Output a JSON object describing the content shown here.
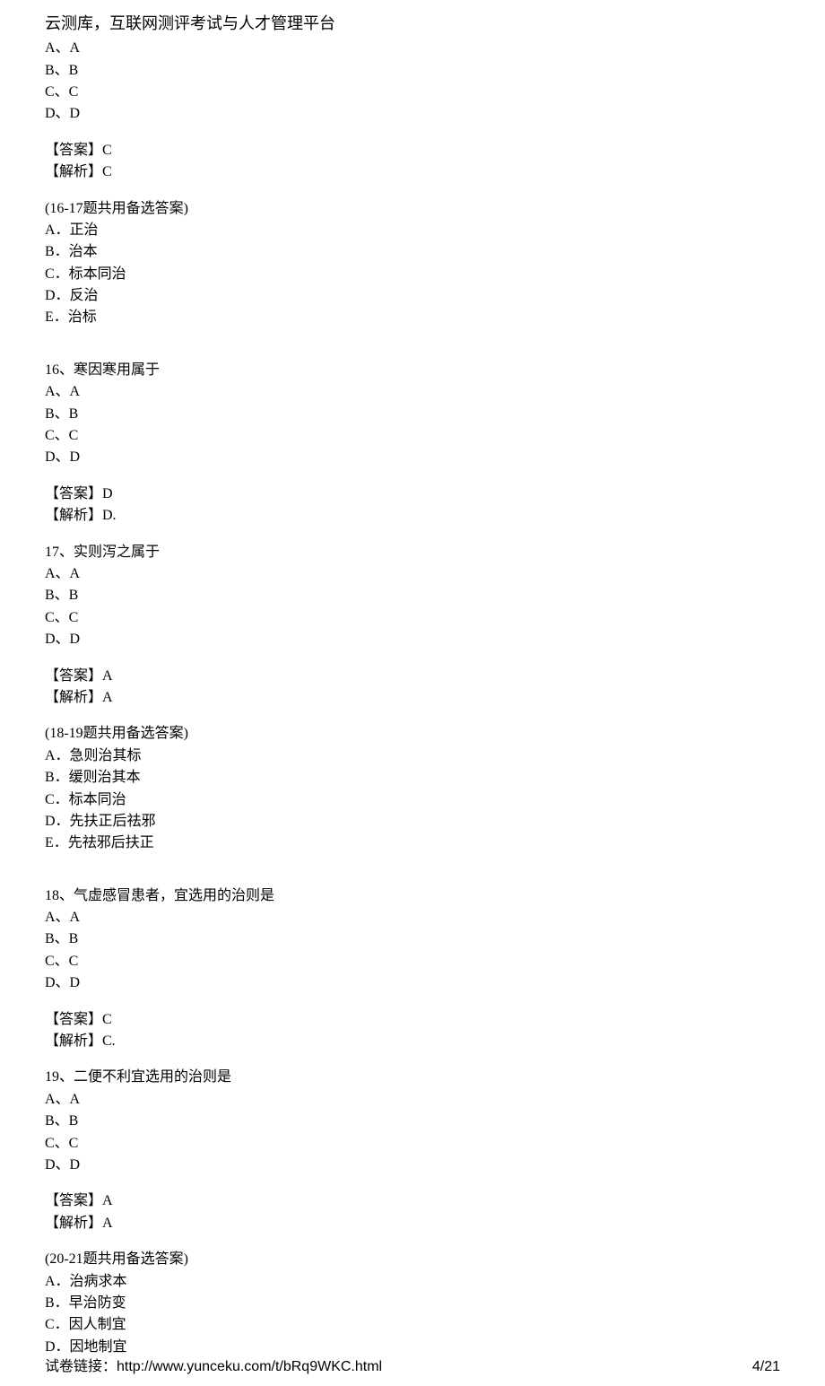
{
  "title": "云测库，互联网测评考试与人才管理平台",
  "topOptions": {
    "a": "A、A",
    "b": "B、B",
    "c": "C、C",
    "d": "D、D"
  },
  "topAnswer": {
    "ans": "【答案】C",
    "exp": "【解析】C"
  },
  "group1617": {
    "header": "(16-17题共用备选答案)",
    "a": "A．正治",
    "b": "B．治本",
    "c": "C．标本同治",
    "d": "D．反治",
    "e": "E．治标"
  },
  "q16": {
    "stem": "16、寒因寒用属于",
    "a": "A、A",
    "b": "B、B",
    "c": "C、C",
    "d": "D、D",
    "ans": "【答案】D",
    "exp": "【解析】D."
  },
  "q17": {
    "stem": "17、实则泻之属于",
    "a": "A、A",
    "b": "B、B",
    "c": "C、C",
    "d": "D、D",
    "ans": "【答案】A",
    "exp": "【解析】A"
  },
  "group1819": {
    "header": "(18-19题共用备选答案)",
    "a": "A．急则治其标",
    "b": "B．缓则治其本",
    "c": "C．标本同治",
    "d": "D．先扶正后祛邪",
    "e": "E．先祛邪后扶正"
  },
  "q18": {
    "stem": "18、气虚感冒患者，宜选用的治则是",
    "a": "A、A",
    "b": "B、B",
    "c": "C、C",
    "d": "D、D",
    "ans": "【答案】C",
    "exp": "【解析】C."
  },
  "q19": {
    "stem": "19、二便不利宜选用的治则是",
    "a": "A、A",
    "b": "B、B",
    "c": "C、C",
    "d": "D、D",
    "ans": "【答案】A",
    "exp": "【解析】A"
  },
  "group2021": {
    "header": "(20-21题共用备选答案)",
    "a": "A．治病求本",
    "b": "B．早治防变",
    "c": "C．因人制宜",
    "d": "D．因地制宜"
  },
  "footer": {
    "linkLabel": "试卷链接：http://www.yunceku.com/t/bRq9WKC.html",
    "page": "4/21"
  }
}
